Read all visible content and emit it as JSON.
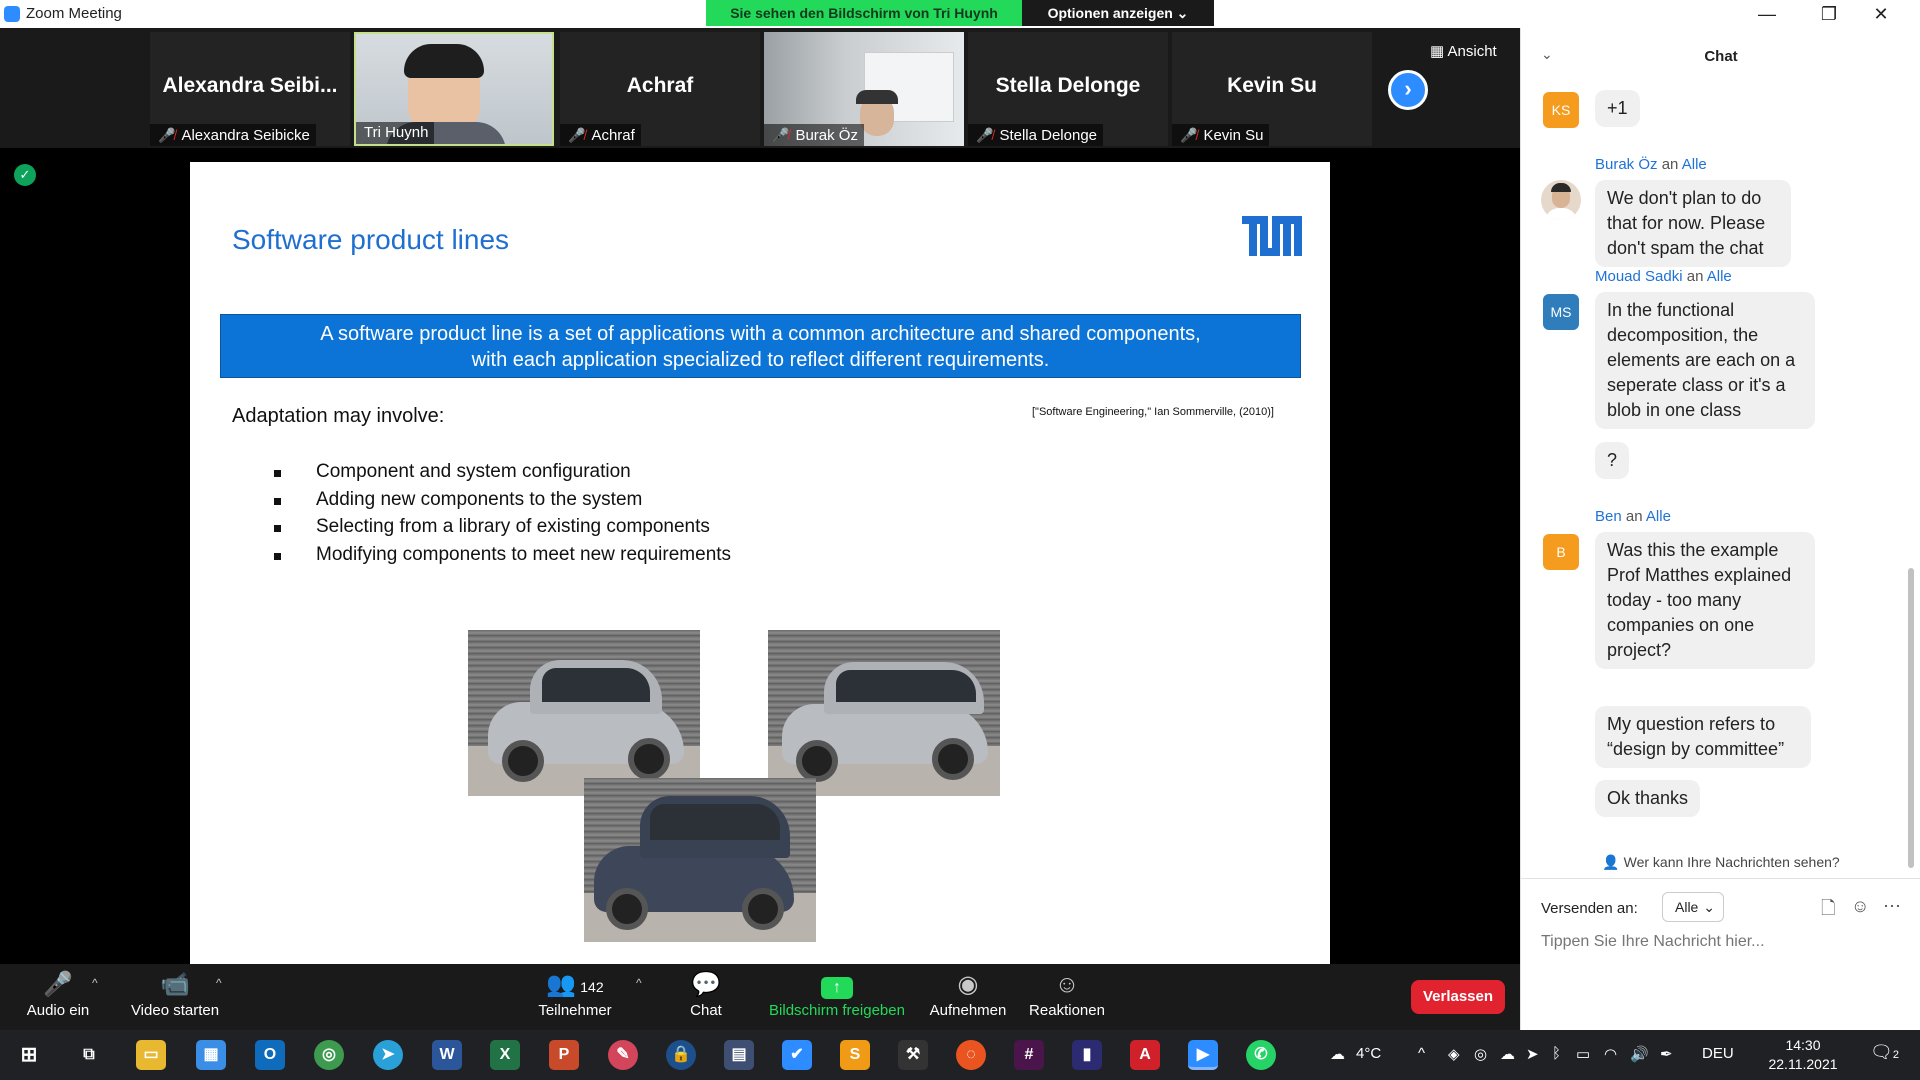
{
  "window": {
    "title": "Zoom Meeting",
    "minimize": "—",
    "maximize": "❐",
    "close": "✕"
  },
  "share_banner": "Sie sehen den Bildschirm von Tri Huynh",
  "options_label": "Optionen anzeigen ⌄",
  "view_label": "Ansicht",
  "participants": [
    {
      "big": "Alexandra  Seibi...",
      "label": "Alexandra Seibicke"
    },
    {
      "big": "",
      "label": "Tri Huynh"
    },
    {
      "big": "Achraf",
      "label": "Achraf"
    },
    {
      "big": "",
      "label": "Burak Öz"
    },
    {
      "big": "Stella Delonge",
      "label": "Stella Delonge"
    },
    {
      "big": "Kevin Su",
      "label": "Kevin Su"
    }
  ],
  "slide": {
    "title": "Software product lines",
    "definition_line1": "A software product line is a set of applications with a common architecture and shared components,",
    "definition_line2": "with each application specialized to reflect different requirements.",
    "adaptation_label": "Adaptation may involve:",
    "citation": "[\"Software Engineering,\" Ian Sommerville, (2010)]",
    "bullets": [
      "Component and system configuration",
      "Adding new components to the system",
      "Selecting from a library of existing components",
      "Modifying components to meet new requirements"
    ]
  },
  "toolbar": {
    "audio": "Audio ein",
    "video": "Video starten",
    "participants": "Teilnehmer",
    "participant_count": "142",
    "chat": "Chat",
    "share": "Bildschirm freigeben",
    "record": "Aufnehmen",
    "reactions": "Reaktionen",
    "leave": "Verlassen"
  },
  "chat": {
    "title": "Chat",
    "reaction_avatar": "KS",
    "reaction": "+1",
    "messages": [
      {
        "sender": "Burak Öz",
        "to_word": "an",
        "to": "Alle",
        "avatar": "",
        "bubbles": [
          "We don't plan to do that for now. Please don't spam the chat"
        ]
      },
      {
        "sender": "Mouad Sadki",
        "to_word": "an",
        "to": "Alle",
        "avatar": "MS",
        "bubbles": [
          "In the functional decomposition, the elements are each on a seperate class or it's a blob in one class",
          "?"
        ]
      },
      {
        "sender": "Ben",
        "to_word": "an",
        "to": "Alle",
        "avatar": "B",
        "bubbles": [
          "Was this the example Prof Matthes explained today - too many companies on one project?",
          "My question refers to “design by committee”",
          "Ok thanks"
        ]
      }
    ],
    "who_can_see": "Wer kann Ihre Nachrichten sehen?",
    "send_to_label": "Versenden an:",
    "send_to_value": "Alle",
    "input_placeholder": "Tippen Sie Ihre Nachricht hier..."
  },
  "taskbar": {
    "weather": "4°C",
    "language": "DEU",
    "time": "14:30",
    "date": "22.11.2021",
    "notification_count": "2"
  },
  "colors": {
    "zoom_blue": "#2d8cff",
    "share_green": "#23d959",
    "leave_red": "#e0232f",
    "slide_blue": "#0b74d6",
    "chat_sender_blue": "#1f72d6"
  }
}
